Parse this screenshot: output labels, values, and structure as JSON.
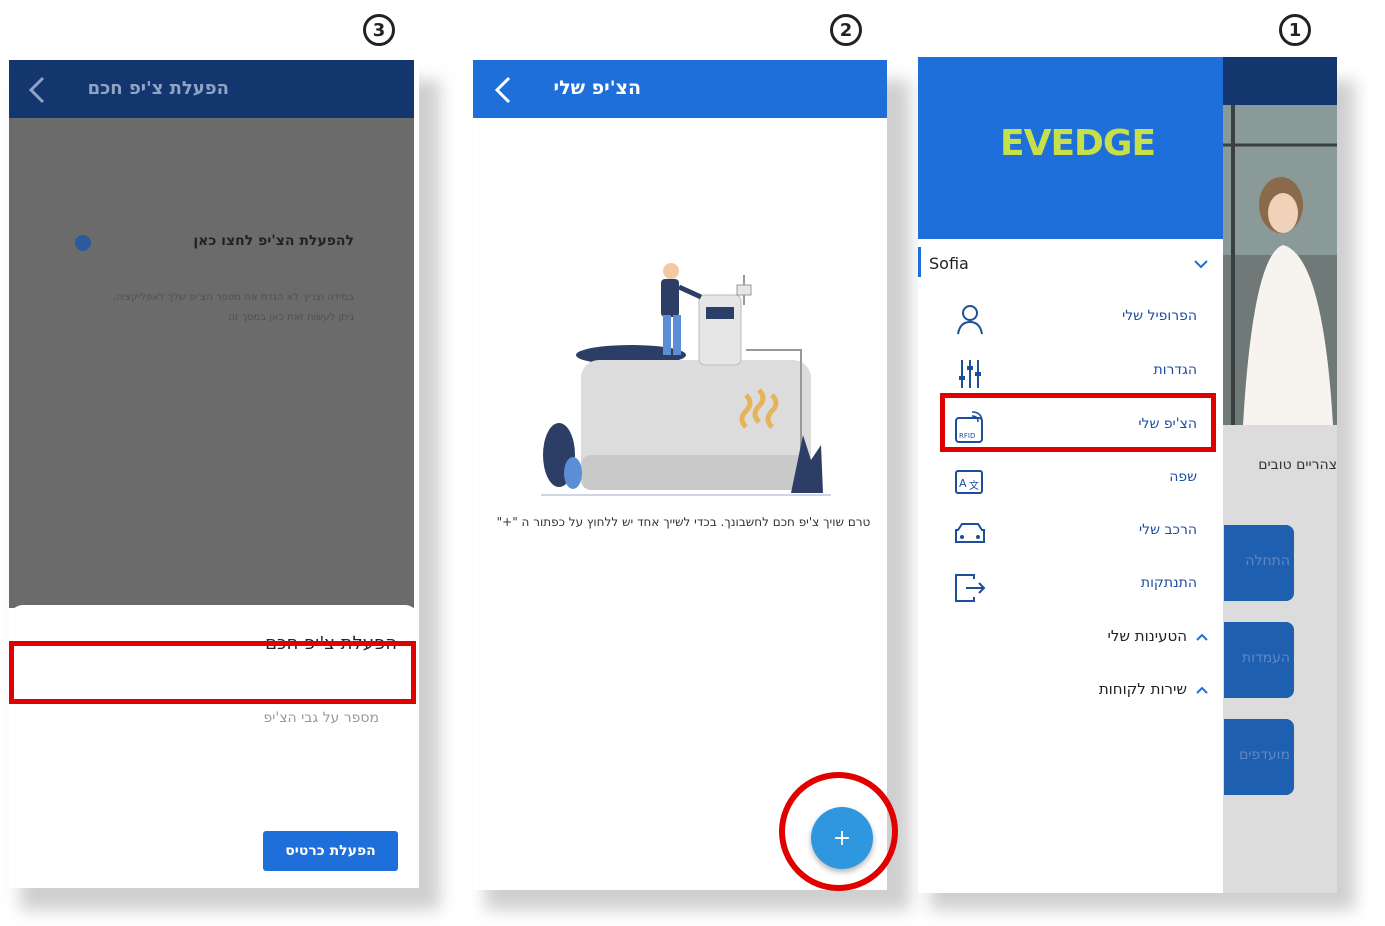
{
  "steps": [
    "3",
    "2",
    "1"
  ],
  "screen3": {
    "header_title": "הפעלת צ'יפ חכם",
    "activate_title": "להפעלת הצ'יפ לחצו כאן",
    "activate_desc": "במידה וצריך לא הגדת את מספר הצ'יפ שלך לאפליקציה, ניתן לעשות זאת כאן במסך זה",
    "sheet_title": "הפעלת צ'יפ חכם",
    "chip_input_placeholder": "מספר על גבי הצ'יפ",
    "activate_button": "הפעלת כרטיס"
  },
  "screen2": {
    "header_title": "הצ'יפ שלי",
    "empty_message": "טרם שויך צ'יפ חכם לחשבונך. בכדי לשייך אחד יש ללחוץ על כפתור ה \"+\"",
    "fab_label": "+"
  },
  "screen1": {
    "logo_text": "EVEDGE",
    "user_name": "Sofia",
    "menu": [
      {
        "label": "הפרופיל שלי",
        "icon": "person-icon"
      },
      {
        "label": "הגדרות",
        "icon": "sliders-icon"
      },
      {
        "label": "הצ'יפ שלי",
        "icon": "rfid-icon"
      },
      {
        "label": "שפה",
        "icon": "translate-icon"
      },
      {
        "label": "הרכב שלי",
        "icon": "car-icon"
      },
      {
        "label": "התנתקות",
        "icon": "logout-icon"
      }
    ],
    "sections": [
      "הטעינות שלי",
      "שירות לקוחות"
    ],
    "background": {
      "greeting": "צהריים טובים",
      "buttons": [
        "התחלה",
        "העמדות",
        "מועדפים"
      ]
    }
  },
  "colors": {
    "primary": "#1e6fd9",
    "dark_header": "#14366e",
    "highlight": "#e00000",
    "logo_green": "#c7e04a"
  }
}
